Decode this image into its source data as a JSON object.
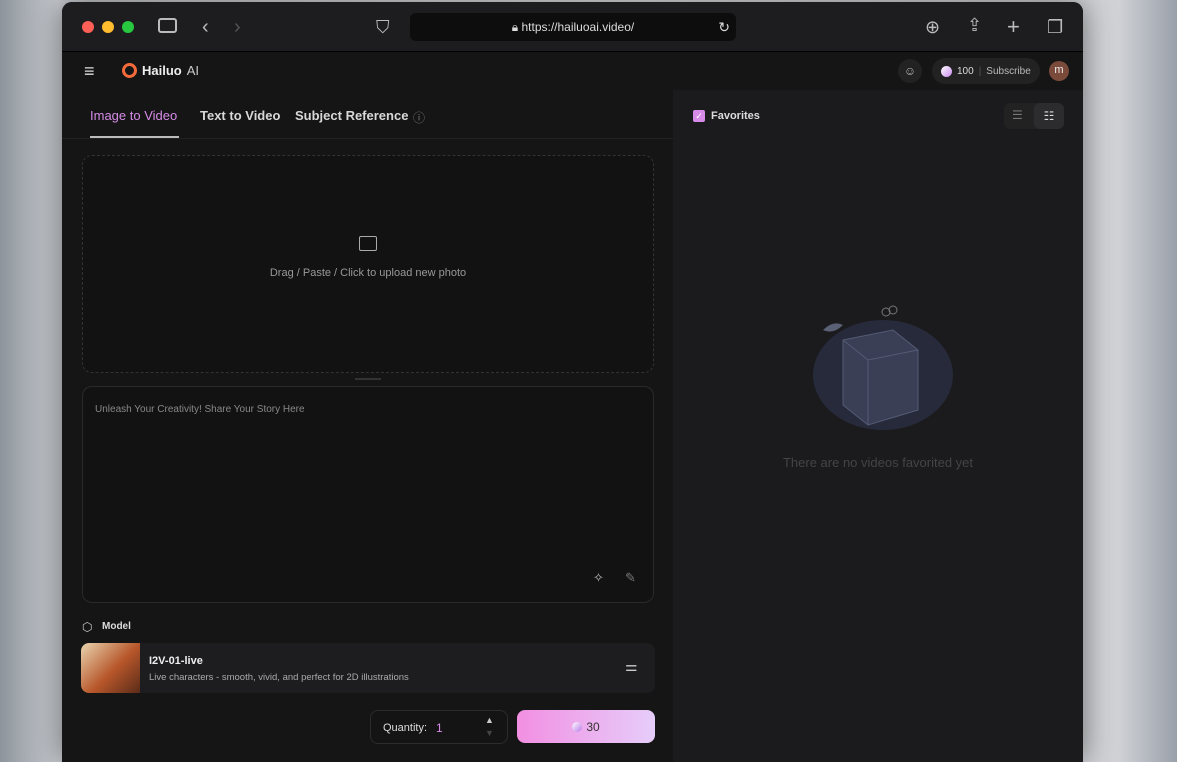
{
  "browser": {
    "url": "https://hailuoai.video/"
  },
  "app": {
    "brand": "Hailuo",
    "brand_suffix": "AI",
    "credits": "100",
    "subscribe": "Subscribe",
    "avatar": "m"
  },
  "tabs": [
    {
      "label": "Image to Video",
      "active": true
    },
    {
      "label": "Text to Video"
    },
    {
      "label": "Subject Reference"
    }
  ],
  "upload": {
    "hint": "Drag / Paste / Click to upload new photo"
  },
  "prompt": {
    "placeholder": "Unleash Your Creativity! Share Your Story Here"
  },
  "model": {
    "heading": "Model",
    "name": "I2V-01-live",
    "description": "Live characters - smooth, vivid, and perfect for 2D illustrations"
  },
  "quantity": {
    "label": "Quantity:",
    "value": "1"
  },
  "generate": {
    "cost": "30"
  },
  "favorites": {
    "label": "Favorites",
    "empty": "There are no videos favorited yet"
  },
  "colors": {
    "accent": "#d78be8"
  }
}
